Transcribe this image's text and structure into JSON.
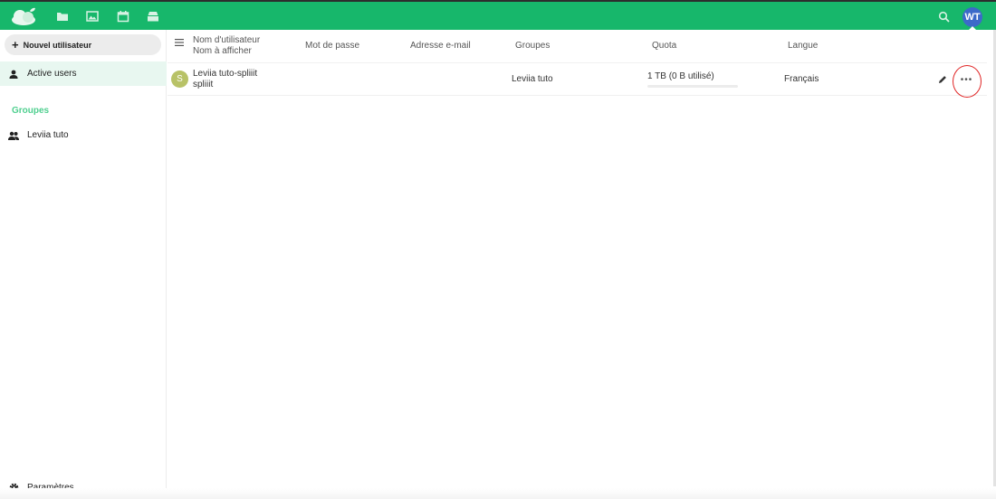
{
  "topbar": {
    "brand_color": "#17b76b",
    "apps": [
      {
        "name": "files",
        "icon": "folder-icon"
      },
      {
        "name": "photos",
        "icon": "image-icon"
      },
      {
        "name": "calendar",
        "icon": "calendar-icon"
      },
      {
        "name": "deck",
        "icon": "archive-icon"
      }
    ],
    "avatar_initials": "WT",
    "avatar_color": "#3c6ac9"
  },
  "sidebar": {
    "new_user_label": "Nouvel utilisateur",
    "active_users_label": "Active users",
    "groups_caption": "Groupes",
    "groups": [
      {
        "label": "Leviia tuto"
      }
    ],
    "settings_label": "Paramètres"
  },
  "table": {
    "headers": {
      "username": "Nom d'utilisateur",
      "display_name": "Nom à afficher",
      "password": "Mot de passe",
      "email": "Adresse e-mail",
      "groups": "Groupes",
      "quota": "Quota",
      "language": "Langue"
    },
    "rows": [
      {
        "avatar_initial": "S",
        "username": "Leviia tuto-spliiit",
        "display_name": "spliiit",
        "password": "",
        "email": "",
        "groups": "Leviia tuto",
        "quota": "1 TB (0 B utilisé)",
        "quota_used_fraction": 0,
        "language": "Français"
      }
    ]
  }
}
